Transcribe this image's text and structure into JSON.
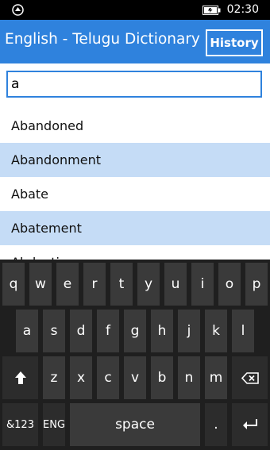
{
  "status_bar": {
    "time": "02:30",
    "left_icon": "notification-app-icon",
    "battery_icon": "battery-charging-icon"
  },
  "header": {
    "title": "English - Telugu Dictionary",
    "history_label": "History"
  },
  "search": {
    "value": "a",
    "placeholder": ""
  },
  "results": [
    "Abandoned",
    "Abandonment",
    "Abate",
    "Abatement",
    "Abduction"
  ],
  "keyboard": {
    "row1": [
      "q",
      "w",
      "e",
      "r",
      "t",
      "y",
      "u",
      "i",
      "o",
      "p"
    ],
    "row2": [
      "a",
      "s",
      "d",
      "f",
      "g",
      "h",
      "j",
      "k",
      "l"
    ],
    "row3": [
      "z",
      "x",
      "c",
      "v",
      "b",
      "n",
      "m"
    ],
    "shift_icon": "shift-arrow-icon",
    "backspace_icon": "backspace-icon",
    "numbers_label": "&123",
    "language_label": "ENG",
    "space_label": "space",
    "period_label": ".",
    "enter_icon": "enter-icon"
  },
  "colors": {
    "accent": "#2f82dd",
    "list_alt_row": "#c5dcf6",
    "keyboard_bg": "#1f1f1f",
    "key_bg": "#3a3a3a"
  }
}
